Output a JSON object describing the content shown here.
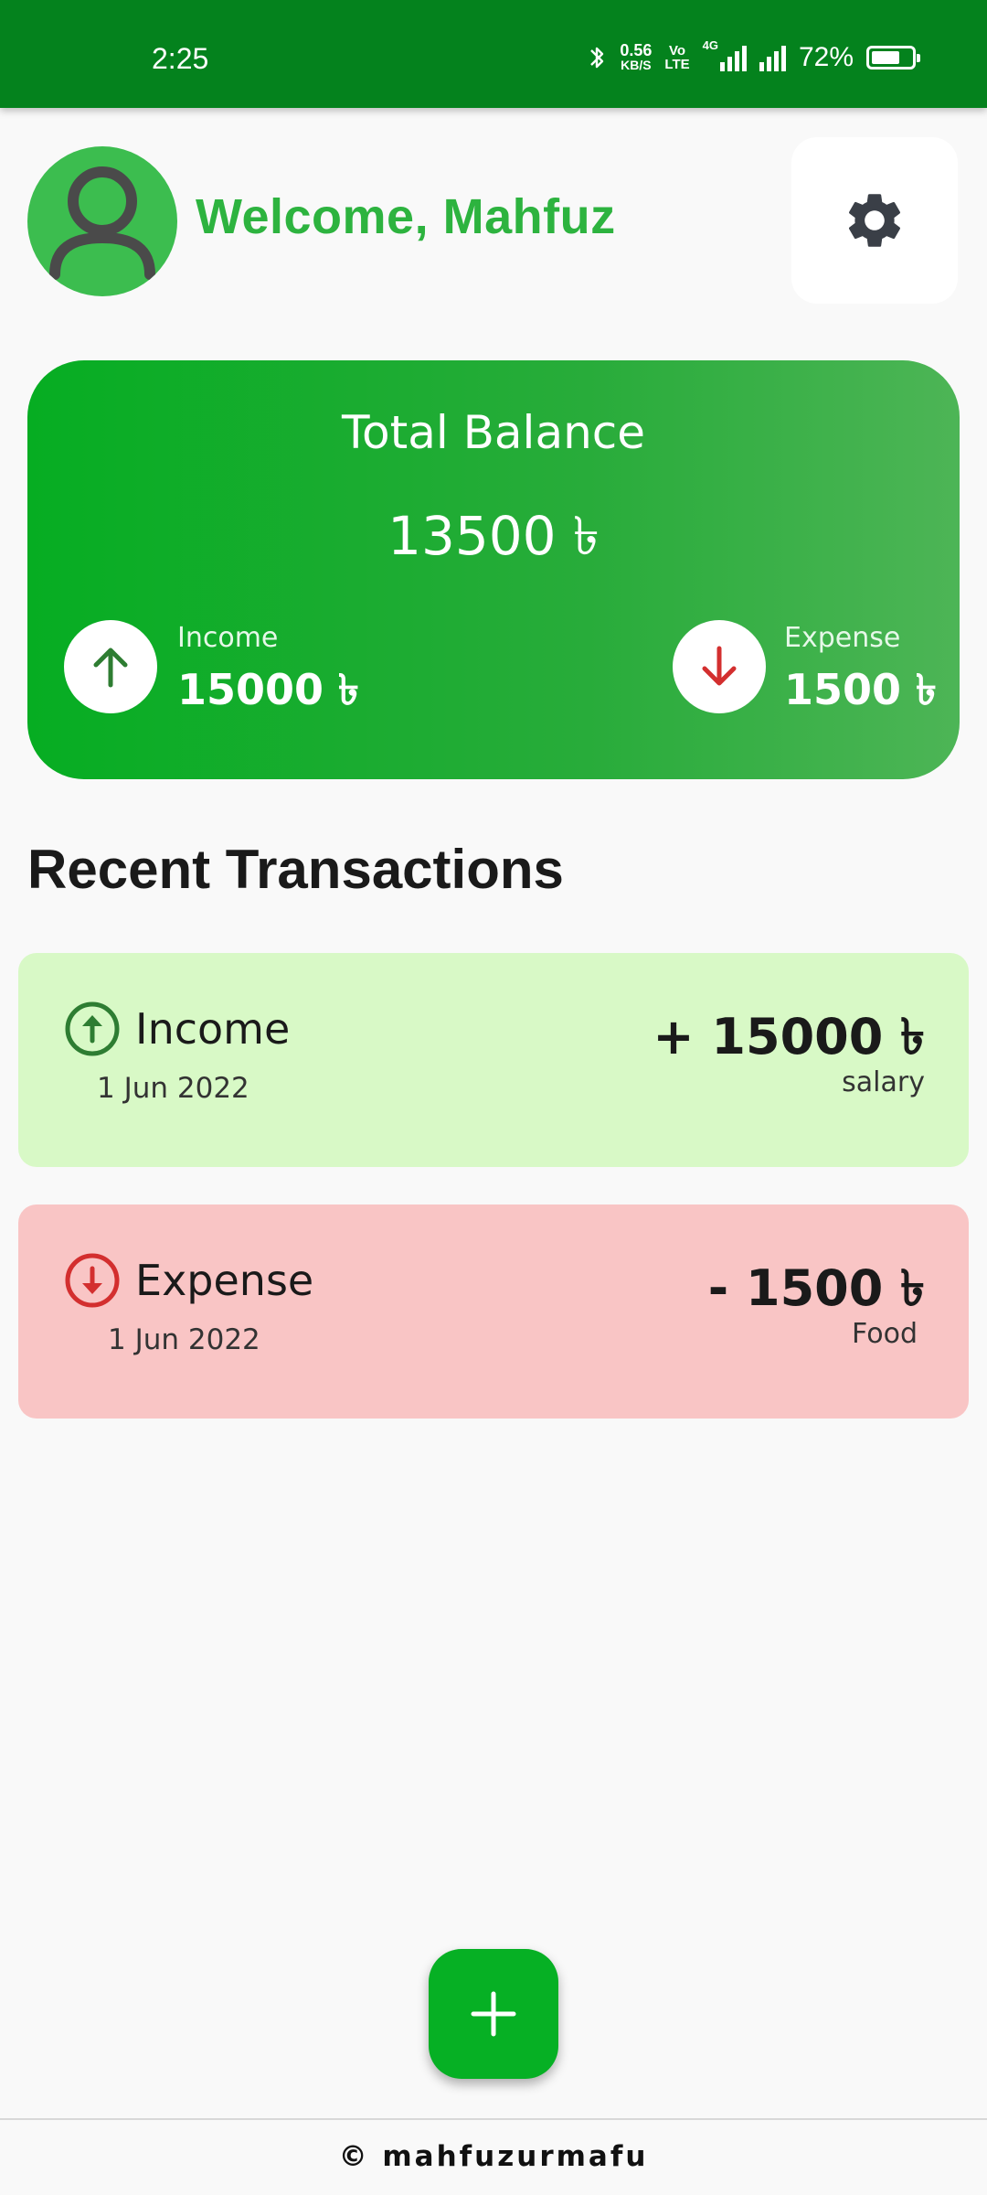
{
  "status_bar": {
    "time": "2:25",
    "speed_value": "0.56",
    "speed_unit": "KB/S",
    "volte_top": "Vo",
    "volte_bottom": "LTE",
    "network": "4G",
    "battery_percent": "72%"
  },
  "header": {
    "welcome": "Welcome, Mahfuz",
    "avatar_icon": "person-icon",
    "settings_icon": "gear-icon"
  },
  "balance_card": {
    "title": "Total Balance",
    "total": "13500 ৳",
    "income_label": "Income",
    "income_value": "15000 ৳",
    "expense_label": "Expense",
    "expense_value": "1500 ৳"
  },
  "recent": {
    "title": "Recent Transactions",
    "items": [
      {
        "type": "Income",
        "date": "1 Jun 2022",
        "amount": "+ 15000 ৳",
        "note": "salary",
        "color": "#d8f9c6"
      },
      {
        "type": "Expense",
        "date": "1 Jun 2022",
        "amount": "- 1500 ৳",
        "note": "Food",
        "color": "#f9c5c5"
      }
    ]
  },
  "fab": {
    "icon": "plus-icon"
  },
  "footer": {
    "text": "© mahfuzurmafu"
  },
  "colors": {
    "status_bar": "#04821d",
    "accent": "#2db33f",
    "income_arrow": "#2e7d32",
    "expense_arrow": "#d32f2f"
  }
}
